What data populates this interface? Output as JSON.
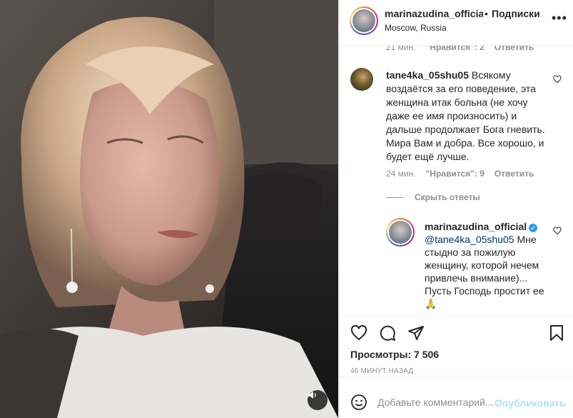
{
  "header": {
    "username": "marinazudina_official",
    "dot": "•",
    "follow_label": "Подписки",
    "location": "Moscow, Russia",
    "more_label": "•••"
  },
  "previous_meta": {
    "time": "21 мин.",
    "likes": "\"Нравится\": 2",
    "reply": "Ответить"
  },
  "comment": {
    "username": "tane4ka_05shu05",
    "text": "Всякому воздаётся за его поведение, эта женщина итак больна (не хочу даже ее имя произносить) и дальше продолжает Бога гневить. Мира Вам и добра. Все хорошо, и будет ещё лучше.",
    "time": "24 мин.",
    "likes": "\"Нравится\": 9",
    "reply": "Ответить",
    "hide_replies": "Скрыть ответы"
  },
  "reply": {
    "username": "marinazudina_official",
    "verified_glyph": "✓",
    "mention": "@tane4ka_05shu05",
    "text": "Мне стыдно за пожилую женщину, которой нечем привлечь внимание)... Пусть Господь простит ее",
    "emoji": "🙏"
  },
  "actions": {
    "views": "Просмотры: 7 506",
    "time_ago": "46 МИНУТ НАЗАД"
  },
  "add_comment": {
    "placeholder": "Добавьте комментарий...",
    "publish_label": "Опубликовать"
  },
  "colors": {
    "link_blue": "#00376b",
    "verified_blue": "#3897f0",
    "publish_disabled": "#b2dffc",
    "muted_text": "#8e8e8e"
  },
  "icons": [
    "sound-icon",
    "more-icon",
    "heart-icon",
    "comment-icon",
    "share-icon",
    "bookmark-icon",
    "emoji-icon",
    "verified-icon"
  ]
}
